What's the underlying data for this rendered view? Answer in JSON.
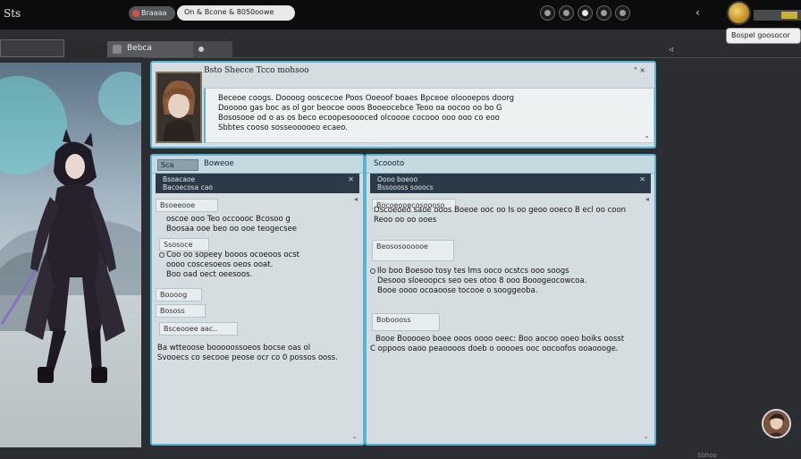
{
  "app": {
    "title": "Sts"
  },
  "topbar": {
    "pill_label": "Braaaa",
    "search_text": "On & Bcone & 8050oowe",
    "balance": "Bospel goosocor"
  },
  "tabs": {
    "active_label": "Bebca"
  },
  "message": {
    "header": "Bsto Shecce Tcco mohsoo",
    "controls": "° ×",
    "lines": [
      "Beceoe coogs. Doooog ooscecoe Poos Ooeoof boaes Bpceoe oloooepos doorg",
      "Dooooo gas boc as ol gor beocoe ooos Booeocebce Teoo oa oocoo oo bo G",
      "Bososooe od o as os beco ecoopesoooced olcoooe cocooo ooo ooo co eoo",
      "Sbbtes cooso sosseooooeo ecaeo."
    ],
    "more": "⌄"
  },
  "left_panel": {
    "icon_label": "Sca",
    "title": "Boweoe",
    "sub_line1": "Bsoacaoe",
    "sub_line2": "Bacoecosa cao",
    "close": "✕",
    "items": [
      {
        "tag": "Bsoeeooe",
        "line1": "oscoe ooo Teo occoooc Bcosoo g",
        "line2": "Boosaa ooe beo oo ooe teogecsee"
      },
      {
        "tag": "Ssosoce",
        "line1": "Coo oo sopeey booos ocoeoos ocst",
        "line2": "oooo coscesoeos oeos ooat.",
        "line3": "Boo oad oect oeesoos."
      },
      {
        "tag": "Boooog",
        "line1": "",
        "line2": ""
      },
      {
        "tag": "Bososs",
        "line1": ""
      },
      {
        "tag": "Bsceooee aac..",
        "line1": "Ba wtteoose booooossoeos bocse oas ol",
        "line2": "Svooecs co secooe peose ocr co 0 possos ooss."
      }
    ],
    "gutter": "⌄"
  },
  "right_panel": {
    "title": "Scoooto",
    "sub_line1": "Oooo boeoo",
    "sub_line2": "Bssoooss sooocs",
    "close": "✕",
    "items": [
      {
        "tag": "Bocoeooecosoooso",
        "line1": "Oscoeoeo saoe ooos Boeoe ooc oo Is oo geoo ooeco B ecl oo coon",
        "line2": "Reoo oo oo ooes"
      },
      {
        "tag": "Beososoooooe",
        "line1": "Ilo boo Boesoo tosy tes lms ooco ocstcs ooo soogs",
        "line2": "Desooo sloeoopcs seo oes otoo 8 ooo Booogeocowcoa.",
        "line3": "Booe oooo ocoaoose tocooe o sooggeoba."
      },
      {
        "tag": "Boboooss",
        "line1": "Booe Booooeo boee ooos oooo oeec: Boo aocoo ooeo boiks oosst",
        "line2": "C oppoos oaoo peaoooos doeb o ooooes ooc oocoofos ooaoooge."
      }
    ],
    "gutter": "⌄"
  },
  "footer": {
    "text": "Sbhoo"
  }
}
